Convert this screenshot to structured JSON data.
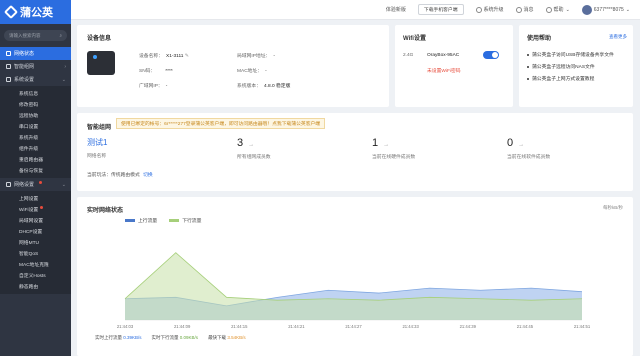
{
  "app": {
    "logo_text": "蒲公英"
  },
  "sidebar": {
    "search_placeholder": "请输入搜索内容",
    "items": [
      {
        "label": "网络状态"
      },
      {
        "label": "智能组网"
      },
      {
        "label": "系统设置"
      }
    ],
    "system_sub": [
      "系统信息",
      "修改密码",
      "远程协助",
      "串口设置",
      "系统升级",
      "组件升级",
      "重启路由器",
      "备份与恢复"
    ],
    "network_label": "网络设置",
    "network_sub": [
      "上网设置",
      "WiFi设置",
      "局域网设置",
      "DHCP设置",
      "网络MTU",
      "智能QoS",
      "MAC地址克隆",
      "自定义Hosts",
      "静态路由"
    ]
  },
  "topbar": {
    "classic": "体验新版",
    "download": "下载手机客户端",
    "upgrade": "系统升级",
    "messages": "消息",
    "help": "帮助",
    "account": "6377****8075"
  },
  "device": {
    "title": "设备信息",
    "name_label": "设备名称：",
    "name_value": "X1-3111",
    "sn_label": "SN码：",
    "sn_value": "****",
    "wan_label": "广域网IP：",
    "wan_value": "-",
    "lan_label": "局域网IP地址：",
    "lan_value": "-",
    "mac_label": "MAC地址：",
    "mac_value": "-",
    "ver_label": "系统版本：",
    "ver_value": "4.8.0 稳定版"
  },
  "wifi": {
    "title": "Wifi设置",
    "band": "2.4G",
    "ssid": "OrayBox-95AC",
    "warning": "未设置WiFi密码"
  },
  "help": {
    "title": "使用帮助",
    "more": "查看更多",
    "items": [
      "蒲公英盒子访问USB存储设备共享文件",
      "蒲公英盒子远程访问NAS文件",
      "蒲公英盒子上网方式设置教程"
    ]
  },
  "smartnet": {
    "title": "智能组网",
    "notice": "使用已绑定的帐号：6r*****277登录蒲公英客户端，即可访问路由器哦！点我下载蒲公英客户端",
    "network_name": "测试1",
    "network_label": "网络名称",
    "play_prefix": "当前玩法：传统路由模式",
    "play_switch": "切换",
    "stats": [
      {
        "value": "3",
        "label": "所有组网成员数"
      },
      {
        "value": "1",
        "label": "当前在线硬件成员数"
      },
      {
        "value": "0",
        "label": "当前在线软件成员数"
      }
    ]
  },
  "traffic": {
    "title": "实时网络状态",
    "unit_note": "每秒kB/秒",
    "legend_up": "上行流量",
    "legend_down": "下行流量",
    "current_up_label": "实时上行流量",
    "current_up": "0.39KB/s",
    "current_down_label": "实时下行流量",
    "current_down": "0.09KB/s",
    "max_down_label": "最快下载",
    "max_down": "3.54KB/s"
  },
  "chart_data": {
    "type": "area",
    "x": [
      "21:44:03",
      "21:44:09",
      "21:44:15",
      "21:44:21",
      "21:44:27",
      "21:44:33",
      "21:44:39",
      "21:44:45",
      "21:44:51"
    ],
    "series": [
      {
        "name": "上行流量",
        "color": "#a9c4ee",
        "values": [
          0.3,
          0.32,
          0.2,
          0.32,
          0.42,
          0.38,
          0.45,
          0.42,
          0.45,
          0.4
        ]
      },
      {
        "name": "下行流量",
        "color": "#c7e0a8",
        "values": [
          0.3,
          0.95,
          0.32,
          0.28,
          0.3,
          0.28,
          0.32,
          0.3,
          0.28,
          0.3
        ]
      }
    ],
    "ylim": [
      0,
      1.2
    ]
  }
}
